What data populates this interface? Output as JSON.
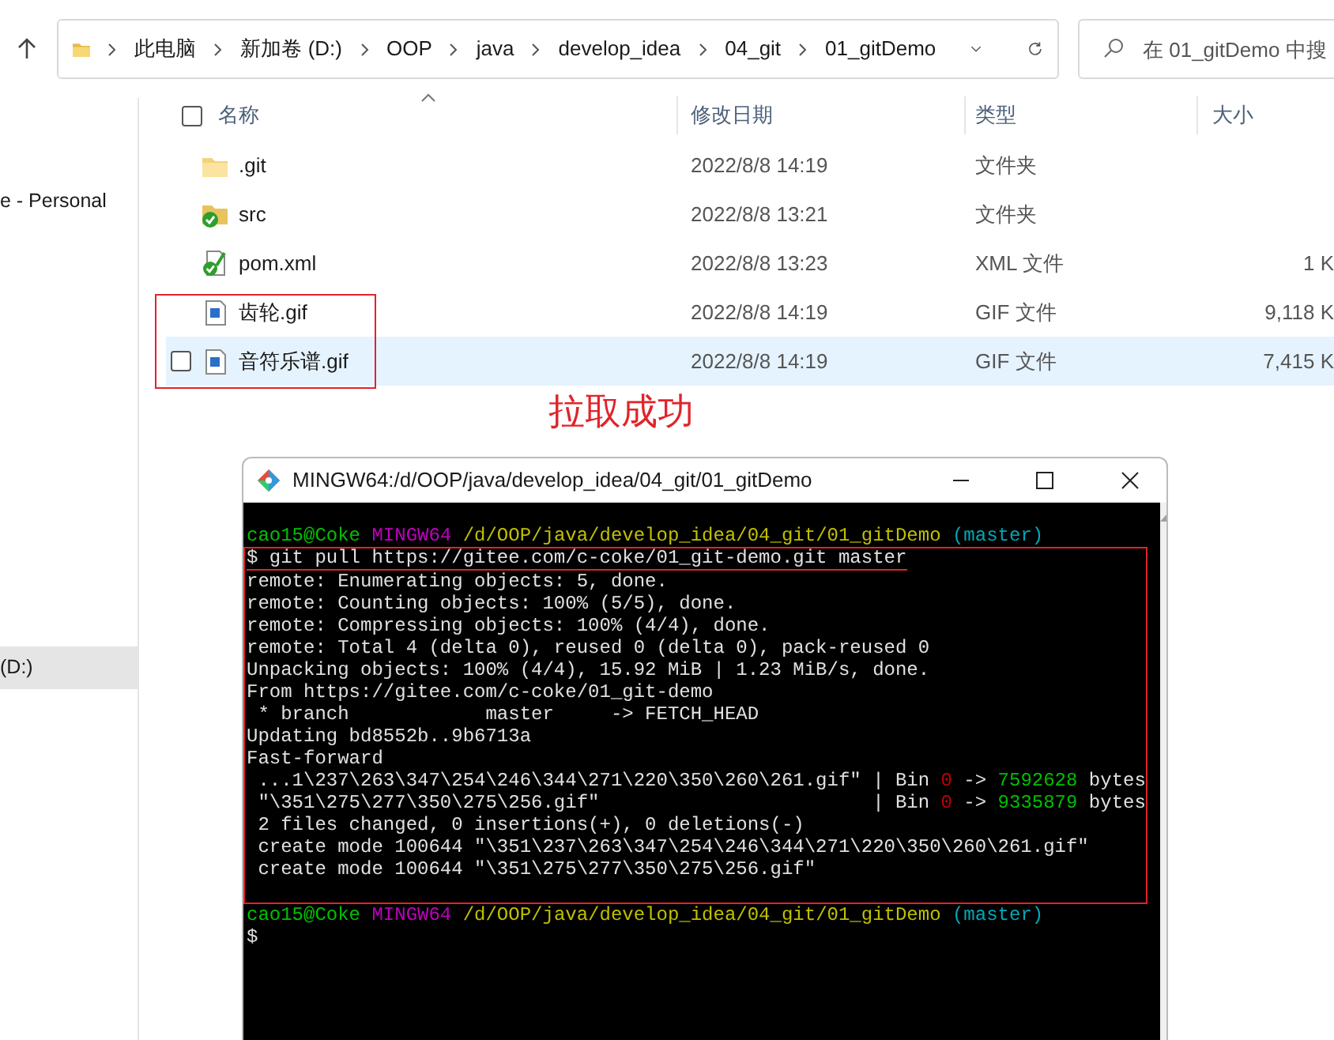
{
  "address_bar": {
    "crumbs": [
      "此电脑",
      "新加卷 (D:)",
      "OOP",
      "java",
      "develop_idea",
      "04_git",
      "01_gitDemo"
    ]
  },
  "search": {
    "placeholder": "在 01_gitDemo 中搜"
  },
  "sidebar": {
    "items": [
      {
        "label": "e - Personal",
        "selected": false
      },
      {
        "label": "(D:)",
        "selected": true
      }
    ]
  },
  "table": {
    "select_all": {
      "checked": false
    },
    "columns": [
      "名称",
      "修改日期",
      "类型",
      "大小"
    ],
    "rows": [
      {
        "kind": "folder",
        "name": ".git",
        "date": "2022/8/8 14:19",
        "type": "文件夹",
        "size": "",
        "selected": false
      },
      {
        "kind": "folder-checked",
        "name": "src",
        "date": "2022/8/8 13:21",
        "type": "文件夹",
        "size": "",
        "selected": false
      },
      {
        "kind": "file-checked",
        "name": "pom.xml",
        "date": "2022/8/8 13:23",
        "type": "XML 文件",
        "size": "1 K",
        "selected": false
      },
      {
        "kind": "image",
        "name": "齿轮.gif",
        "date": "2022/8/8 14:19",
        "type": "GIF 文件",
        "size": "9,118 K",
        "selected": false
      },
      {
        "kind": "image",
        "name": "音符乐谱.gif",
        "date": "2022/8/8 14:19",
        "type": "GIF 文件",
        "size": "7,415 K",
        "selected": true
      }
    ]
  },
  "annotation": {
    "label": "拉取成功"
  },
  "terminal": {
    "title": "MINGW64:/d/OOP/java/develop_idea/04_git/01_gitDemo",
    "blocks": [
      {
        "framed": false,
        "lines": [
          {
            "underlined": false,
            "segments": [
              {
                "text": "cao15@Coke ",
                "color": "#00c000"
              },
              {
                "text": "MINGW64 ",
                "color": "#c000c0"
              },
              {
                "text": "/d/OOP/java/develop_idea/04_git/01_gitDemo ",
                "color": "#c0c000"
              },
              {
                "text": "(master)",
                "color": "#00a8b8"
              }
            ]
          }
        ]
      },
      {
        "framed": true,
        "lines": [
          {
            "underlined": true,
            "segments": [
              {
                "text": "$ git pull https://gitee.com/c-coke/01_git-demo.git master",
                "color": "#e0e0e0"
              }
            ]
          },
          {
            "underlined": false,
            "segments": [
              {
                "text": "remote: Enumerating objects: 5, done.",
                "color": "#e0e0e0"
              }
            ]
          },
          {
            "underlined": false,
            "segments": [
              {
                "text": "remote: Counting objects: 100% (5/5), done.",
                "color": "#e0e0e0"
              }
            ]
          },
          {
            "underlined": false,
            "segments": [
              {
                "text": "remote: Compressing objects: 100% (4/4), done.",
                "color": "#e0e0e0"
              }
            ]
          },
          {
            "underlined": false,
            "segments": [
              {
                "text": "remote: Total 4 (delta 0), reused 0 (delta 0), pack-reused 0",
                "color": "#e0e0e0"
              }
            ]
          },
          {
            "underlined": false,
            "segments": [
              {
                "text": "Unpacking objects: 100% (4/4), 15.92 MiB | 1.23 MiB/s, done.",
                "color": "#e0e0e0"
              }
            ]
          },
          {
            "underlined": false,
            "segments": [
              {
                "text": "From https://gitee.com/c-coke/01_git-demo",
                "color": "#e0e0e0"
              }
            ]
          },
          {
            "underlined": false,
            "segments": [
              {
                "text": " * branch            master     -> FETCH_HEAD",
                "color": "#e0e0e0"
              }
            ]
          },
          {
            "underlined": false,
            "segments": [
              {
                "text": "Updating bd8552b..9b6713a",
                "color": "#e0e0e0"
              }
            ]
          },
          {
            "underlined": false,
            "segments": [
              {
                "text": "Fast-forward",
                "color": "#e0e0e0"
              }
            ]
          },
          {
            "underlined": false,
            "segments": [
              {
                "text": " ...1\\237\\263\\347\\254\\246\\344\\271\\220\\350\\260\\261.gif\" | Bin ",
                "color": "#e0e0e0"
              },
              {
                "text": "0",
                "color": "#c00000"
              },
              {
                "text": " -> ",
                "color": "#e0e0e0"
              },
              {
                "text": "7592628",
                "color": "#00c000"
              },
              {
                "text": " bytes",
                "color": "#e0e0e0"
              }
            ]
          },
          {
            "underlined": false,
            "segments": [
              {
                "text": " \"\\351\\275\\277\\350\\275\\256.gif\"                        | Bin ",
                "color": "#e0e0e0"
              },
              {
                "text": "0",
                "color": "#c00000"
              },
              {
                "text": " -> ",
                "color": "#e0e0e0"
              },
              {
                "text": "9335879",
                "color": "#00c000"
              },
              {
                "text": " bytes",
                "color": "#e0e0e0"
              }
            ]
          },
          {
            "underlined": false,
            "segments": [
              {
                "text": " 2 files changed, 0 insertions(+), 0 deletions(-)",
                "color": "#e0e0e0"
              }
            ]
          },
          {
            "underlined": false,
            "segments": [
              {
                "text": " create mode 100644 \"\\351\\237\\263\\347\\254\\246\\344\\271\\220\\350\\260\\261.gif\"",
                "color": "#e0e0e0"
              }
            ]
          },
          {
            "underlined": false,
            "segments": [
              {
                "text": " create mode 100644 \"\\351\\275\\277\\350\\275\\256.gif\"",
                "color": "#e0e0e0"
              }
            ]
          }
        ]
      },
      {
        "framed": false,
        "lines": [
          {
            "underlined": false,
            "segments": [
              {
                "text": "cao15@Coke ",
                "color": "#00c000"
              },
              {
                "text": "MINGW64 ",
                "color": "#c000c0"
              },
              {
                "text": "/d/OOP/java/develop_idea/04_git/01_gitDemo ",
                "color": "#c0c000"
              },
              {
                "text": "(master)",
                "color": "#00a8b8"
              }
            ]
          },
          {
            "underlined": false,
            "segments": [
              {
                "text": "$",
                "color": "#e0e0e0"
              }
            ]
          }
        ]
      }
    ]
  }
}
